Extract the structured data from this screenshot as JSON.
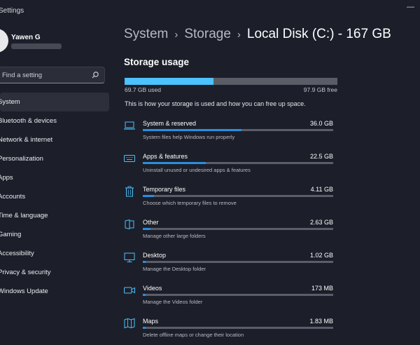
{
  "app": {
    "title": "Settings"
  },
  "user": {
    "name": "Yawen G"
  },
  "search": {
    "placeholder": "Find a setting"
  },
  "sidebar": {
    "items": [
      {
        "label": "System",
        "active": true,
        "icon": "monitor-icon"
      },
      {
        "label": "Bluetooth & devices",
        "icon": "bluetooth-icon"
      },
      {
        "label": "Network & internet",
        "icon": "wifi-icon"
      },
      {
        "label": "Personalization",
        "icon": "brush-icon"
      },
      {
        "label": "Apps",
        "icon": "apps-icon"
      },
      {
        "label": "Accounts",
        "icon": "person-icon"
      },
      {
        "label": "Time & language",
        "icon": "clock-icon"
      },
      {
        "label": "Gaming",
        "icon": "gamepad-icon"
      },
      {
        "label": "Accessibility",
        "icon": "accessibility-icon"
      },
      {
        "label": "Privacy & security",
        "icon": "shield-icon"
      },
      {
        "label": "Windows Update",
        "icon": "update-icon"
      }
    ]
  },
  "breadcrumb": {
    "level1": "System",
    "level2": "Storage",
    "current": "Local Disk (C:) - 167 GB",
    "separator": "›"
  },
  "storage": {
    "section_title": "Storage usage",
    "used_label": "69.7 GB used",
    "free_label": "97.9 GB free",
    "used_fraction": 0.417,
    "info_text": "This is how your storage is used and how you can free up space.",
    "categories": [
      {
        "name": "System & reserved",
        "size": "36.0 GB",
        "desc": "System files help Windows run properly",
        "fraction": 0.52,
        "icon": "laptop-icon"
      },
      {
        "name": "Apps & features",
        "size": "22.5 GB",
        "desc": "Uninstall unused or undesired apps & features",
        "fraction": 0.33,
        "icon": "keyboard-icon"
      },
      {
        "name": "Temporary files",
        "size": "4.11 GB",
        "desc": "Choose which temporary files to remove",
        "fraction": 0.06,
        "icon": "trash-icon"
      },
      {
        "name": "Other",
        "size": "2.63 GB",
        "desc": "Manage other large folders",
        "fraction": 0.04,
        "icon": "folder-icon"
      },
      {
        "name": "Desktop",
        "size": "1.02 GB",
        "desc": "Manage the Desktop folder",
        "fraction": 0.015,
        "icon": "desktop-icon"
      },
      {
        "name": "Videos",
        "size": "173 MB",
        "desc": "Manage the Videos folder",
        "fraction": 0.004,
        "icon": "video-icon"
      },
      {
        "name": "Maps",
        "size": "1.83 MB",
        "desc": "Delete offline maps or change their location",
        "fraction": 0.002,
        "icon": "map-icon"
      }
    ]
  },
  "colors": {
    "accent": "#4cc2ff",
    "category_fill": "#2a8ee0",
    "background": "#1c1f2a"
  }
}
